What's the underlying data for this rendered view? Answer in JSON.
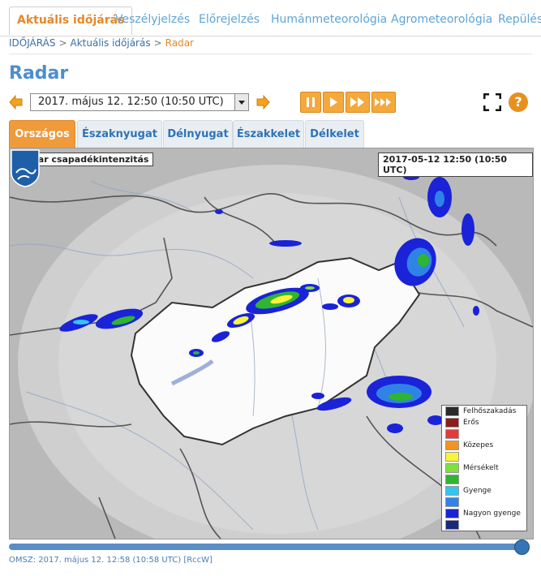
{
  "nav": {
    "tabs": [
      {
        "label": "Aktuális időjárás",
        "active": true
      },
      {
        "label": "Veszélyjelzés"
      },
      {
        "label": "Előrejelzés"
      },
      {
        "label": "Humánmeteorológia"
      },
      {
        "label": "Agrometeorológia"
      },
      {
        "label": "Repülés"
      }
    ]
  },
  "breadcrumb": [
    "IDŐJÁRÁS",
    "Aktuális időjárás",
    "Radar"
  ],
  "page": {
    "title": "Radar"
  },
  "selector": {
    "value": "2017. május 12. 12:50 (10:50  UTC)"
  },
  "region_tabs": [
    "Országos",
    "Északnyugat",
    "Délnyugat",
    "Északkelet",
    "Délkelet"
  ],
  "map": {
    "label_left": "Radar csapadékintenzitás",
    "label_right": "2017-05-12 12:50 (10:50 UTC)",
    "logo_text": "OMSZ"
  },
  "legend": [
    {
      "label": "Felhőszakadás",
      "color": "#2b2b2b"
    },
    {
      "label": "Erős",
      "color": "#8a1e1e"
    },
    {
      "label": "",
      "color": "#e63a3a"
    },
    {
      "label": "Közepes",
      "color": "#f29420"
    },
    {
      "label": "",
      "color": "#f7f43b"
    },
    {
      "label": "Mérsékelt",
      "color": "#7fe040"
    },
    {
      "label": "",
      "color": "#2fb52f"
    },
    {
      "label": "Gyenge",
      "color": "#33c4ef"
    },
    {
      "label": "",
      "color": "#2f83e6"
    },
    {
      "label": "Nagyon gyenge",
      "color": "#1a23d8"
    },
    {
      "label": "",
      "color": "#1a2a7a"
    }
  ],
  "footer": {
    "text": "OMSZ: 2017. május 12. 12:58 (10:58  UTC)",
    "link": "[RccW]"
  },
  "colors": {
    "accent": "#e3892b",
    "link": "#5ea5d8",
    "title": "#4c8ed0"
  }
}
